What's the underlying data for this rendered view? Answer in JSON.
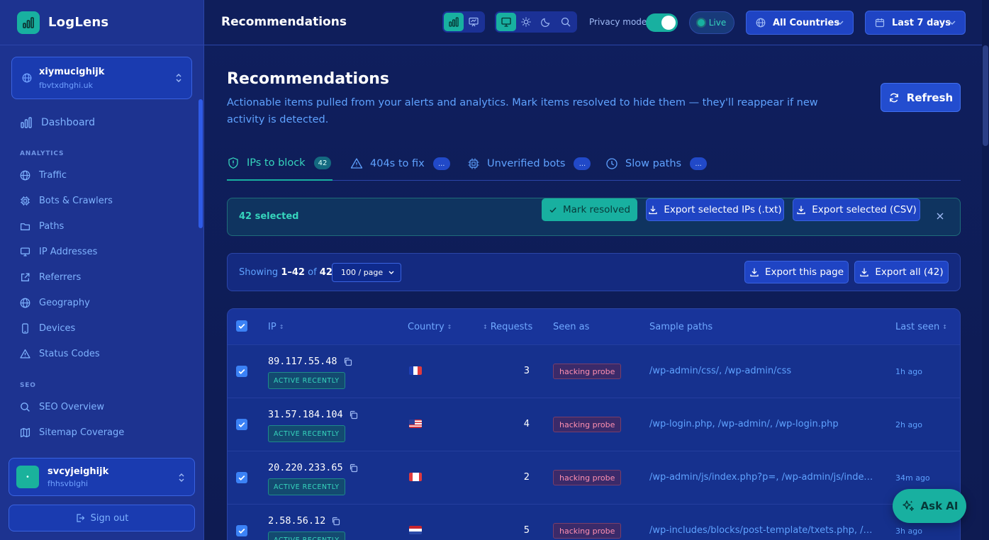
{
  "app": {
    "name": "LogLens"
  },
  "site": {
    "name": "xiymucighijk",
    "domain": "fbvtxdhghi.uk"
  },
  "sidebar": {
    "dashboard": "Dashboard",
    "sections": [
      {
        "title": "ANALYTICS",
        "items": [
          "Traffic",
          "Bots & Crawlers",
          "Paths",
          "IP Addresses",
          "Referrers",
          "Geography",
          "Devices",
          "Status Codes"
        ]
      },
      {
        "title": "SEO",
        "items": [
          "SEO Overview",
          "Sitemap Coverage"
        ]
      }
    ]
  },
  "user": {
    "name": "svcyjeighijk",
    "sub": "fhhsvblghi",
    "avatar_text": "•"
  },
  "signout": "Sign out",
  "topbar": {
    "title": "Recommendations",
    "privacy_label": "Privacy mode",
    "privacy_on": true,
    "live_label": "Live",
    "country_filter": "All Countries",
    "date_filter": "Last 7 days"
  },
  "page": {
    "title": "Recommendations",
    "description": "Actionable items pulled from your alerts and analytics. Mark items resolved to hide them — they'll reappear if new activity is detected.",
    "refresh_label": "Refresh"
  },
  "tabs": [
    {
      "label": "IPs to block",
      "badge": "42",
      "icon": "shield-icon",
      "active": true
    },
    {
      "label": "404s to fix",
      "badge": "...",
      "icon": "warning-icon",
      "active": false
    },
    {
      "label": "Unverified bots",
      "badge": "...",
      "icon": "chip-icon",
      "active": false
    },
    {
      "label": "Slow paths",
      "badge": "...",
      "icon": "clock-icon",
      "active": false
    }
  ],
  "selection": {
    "count_label": "42 selected",
    "mark_resolved": "Mark resolved",
    "export_ips": "Export selected IPs (.txt)",
    "export_csv": "Export selected (CSV)"
  },
  "pager": {
    "showing_prefix": "Showing",
    "range": "1–42",
    "of": "of",
    "total": "42",
    "per_page": "100 / page",
    "export_page": "Export this page",
    "export_all": "Export all (42)"
  },
  "table": {
    "headers": {
      "ip": "IP",
      "country": "Country",
      "requests": "Requests",
      "seen_as": "Seen as",
      "sample_paths": "Sample paths",
      "last_seen": "Last seen"
    },
    "rows": [
      {
        "ip": "89.117.55.48",
        "badge": "ACTIVE RECENTLY",
        "country": "FR",
        "requests": "3",
        "seen_as": "hacking probe",
        "paths": "/wp-admin/css/, /wp-admin/css",
        "last_seen": "1h ago"
      },
      {
        "ip": "31.57.184.104",
        "badge": "ACTIVE RECENTLY",
        "country": "US",
        "requests": "4",
        "seen_as": "hacking probe",
        "paths": "/wp-login.php, /wp-admin/, /wp-login.php",
        "last_seen": "2h ago"
      },
      {
        "ip": "20.220.233.65",
        "badge": "ACTIVE RECENTLY",
        "country": "CA",
        "requests": "2",
        "seen_as": "hacking probe",
        "paths": "/wp-admin/js/index.php?p=, /wp-admin/js/index.php",
        "last_seen": "34m ago"
      },
      {
        "ip": "2.58.56.12",
        "badge": "ACTIVE RECENTLY",
        "country": "NL",
        "requests": "5",
        "seen_as": "hacking probe",
        "paths": "/wp-includes/blocks/post-template/txets.php, /wp-includes",
        "last_seen": "3h ago"
      }
    ]
  },
  "ask_ai": "Ask AI",
  "colors": {
    "accent": "#18b0a0",
    "primary": "#1f44c4",
    "background": "#0f1d55",
    "sidebar": "#1d3390"
  }
}
